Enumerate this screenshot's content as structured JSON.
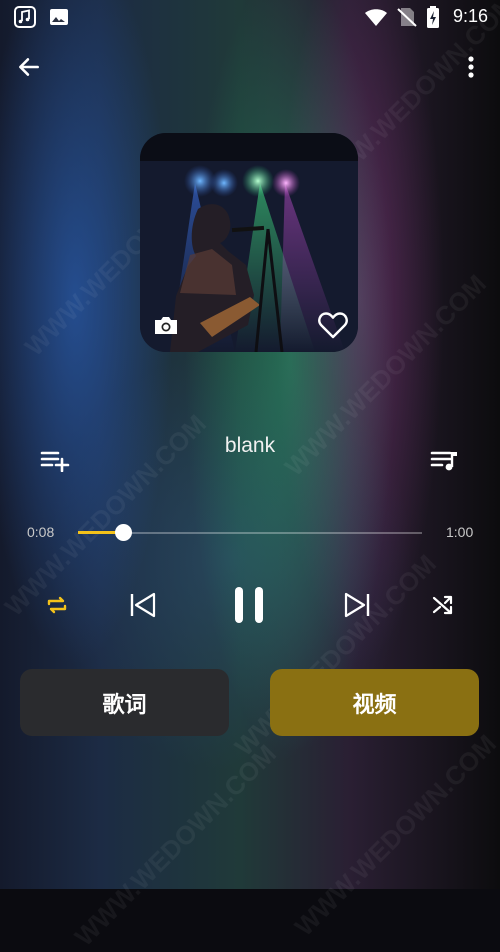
{
  "status_bar": {
    "time": "9:16",
    "icons": [
      "music-app-icon",
      "gallery-icon",
      "wifi-icon",
      "no-sim-icon",
      "battery-charging-icon"
    ]
  },
  "header": {
    "back_icon": "arrow-left-icon",
    "menu_icon": "more-vert-icon"
  },
  "album": {
    "camera_icon": "camera-icon",
    "favorite_icon": "heart-outline-icon"
  },
  "song": {
    "title": "blank"
  },
  "actions": {
    "add_to_playlist_icon": "playlist-add-icon",
    "queue_icon": "queue-music-icon"
  },
  "progress": {
    "current": "0:08",
    "total": "1:00",
    "fraction": 0.13,
    "fill_color": "#f4c21a"
  },
  "controls": {
    "repeat_icon": "repeat-icon",
    "previous_icon": "skip-previous-icon",
    "play_pause_icon": "pause-icon",
    "next_icon": "skip-next-icon",
    "shuffle_icon": "shuffle-icon",
    "accent": "#f4c21a"
  },
  "buttons": {
    "lyrics_label": "歌词",
    "video_label": "视频",
    "lyrics_color": "#2a2b2e",
    "video_color": "#8a7012"
  },
  "watermark_text": "WWW.WEDOWN.COM"
}
